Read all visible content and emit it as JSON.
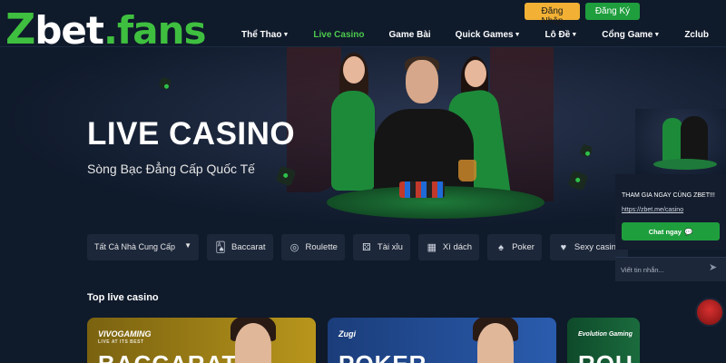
{
  "brand": {
    "logo_z": "Z",
    "logo_bet": "bet",
    "logo_dot": ".",
    "logo_fans": "fans"
  },
  "auth": {
    "login_label": "Đăng Nhập",
    "register_label": "Đăng Ký"
  },
  "nav": {
    "items": [
      {
        "label": "Thể Thao",
        "dropdown": true
      },
      {
        "label": "Live Casino",
        "active": true
      },
      {
        "label": "Game Bài"
      },
      {
        "label": "Quick Games",
        "dropdown": true
      },
      {
        "label": "Lô Đề",
        "dropdown": true
      },
      {
        "label": "Cổng Game",
        "dropdown": true
      },
      {
        "label": "Zclub"
      }
    ]
  },
  "hero": {
    "title": "LIVE CASINO",
    "subtitle": "Sòng Bạc Đẳng Cấp Quốc Tế"
  },
  "filters": {
    "provider_select": "Tất Cả Nhà Cung Cấp",
    "chips": [
      {
        "label": "Baccarat",
        "icon": "baccarat-icon"
      },
      {
        "label": "Roulette",
        "icon": "roulette-icon"
      },
      {
        "label": "Tài xỉu",
        "icon": "dice-icon"
      },
      {
        "label": "Xì dách",
        "icon": "cards-icon"
      },
      {
        "label": "Poker",
        "icon": "poker-icon"
      },
      {
        "label": "Sexy casino",
        "icon": "sexy-casino-icon"
      }
    ]
  },
  "section": {
    "title": "Top live casino"
  },
  "cards": [
    {
      "brand": "VIVOGAMING",
      "brand_sub": "LIVE AT ITS BEST",
      "big": "BACCARAT"
    },
    {
      "brand": "Zugi",
      "big": "POKER"
    },
    {
      "brand": "Evolution Gaming",
      "big": "ROU"
    }
  ],
  "chat": {
    "message": "THAM GIA NGAY CÙNG ZBET!!!",
    "link": "https://zbet.me/casino",
    "button_label": "Chat ngay",
    "input_placeholder": "Viết tin nhắn..."
  },
  "colors": {
    "accent_green": "#3fbf3f",
    "login_yellow": "#f2b134",
    "background": "#0f1a2b"
  }
}
